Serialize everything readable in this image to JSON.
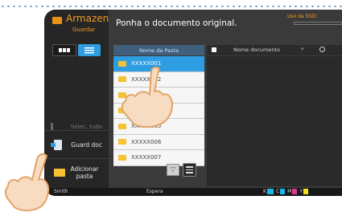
{
  "app": {
    "title": "Armazen",
    "subtitle": "Guardar"
  },
  "prompt": "Ponha o documento original.",
  "ssd_label": "Uso da SSDi",
  "folder_column_header": "Nome da Pasta",
  "document_column_header": "Nome documento",
  "folders": [
    {
      "name": "XXXXX001",
      "selected": true
    },
    {
      "name": "XXXXX002",
      "selected": false
    },
    {
      "name": "",
      "selected": false
    },
    {
      "name": "",
      "selected": false
    },
    {
      "name": "XXXXX005",
      "selected": false
    },
    {
      "name": "XXXXX006",
      "selected": false
    },
    {
      "name": "XXXXX007",
      "selected": false
    }
  ],
  "sidebar": {
    "select_all": "Selec. tudo",
    "store_doc": "Guard doc",
    "add_folder": "Adicionar pasta"
  },
  "status": {
    "user": "Smith",
    "state": "Espera",
    "toner": [
      "K",
      "C",
      "M",
      "Y"
    ]
  },
  "colors": {
    "accent": "#2f9de2",
    "brand_orange": "#f19a22",
    "folder": "#f4c232",
    "toner_c": "#1fb4e6",
    "toner_m": "#e0388f",
    "toner_y": "#f2e21c",
    "toner_k": "#202020"
  },
  "icons": [
    "storage-app-icon",
    "grid-view-icon",
    "list-view-icon",
    "lock-icon",
    "clock-icon",
    "folder-icon",
    "store-document-icon",
    "add-folder-icon",
    "scroll-down-icon",
    "menu-icon",
    "pointing-hand-icon"
  ]
}
